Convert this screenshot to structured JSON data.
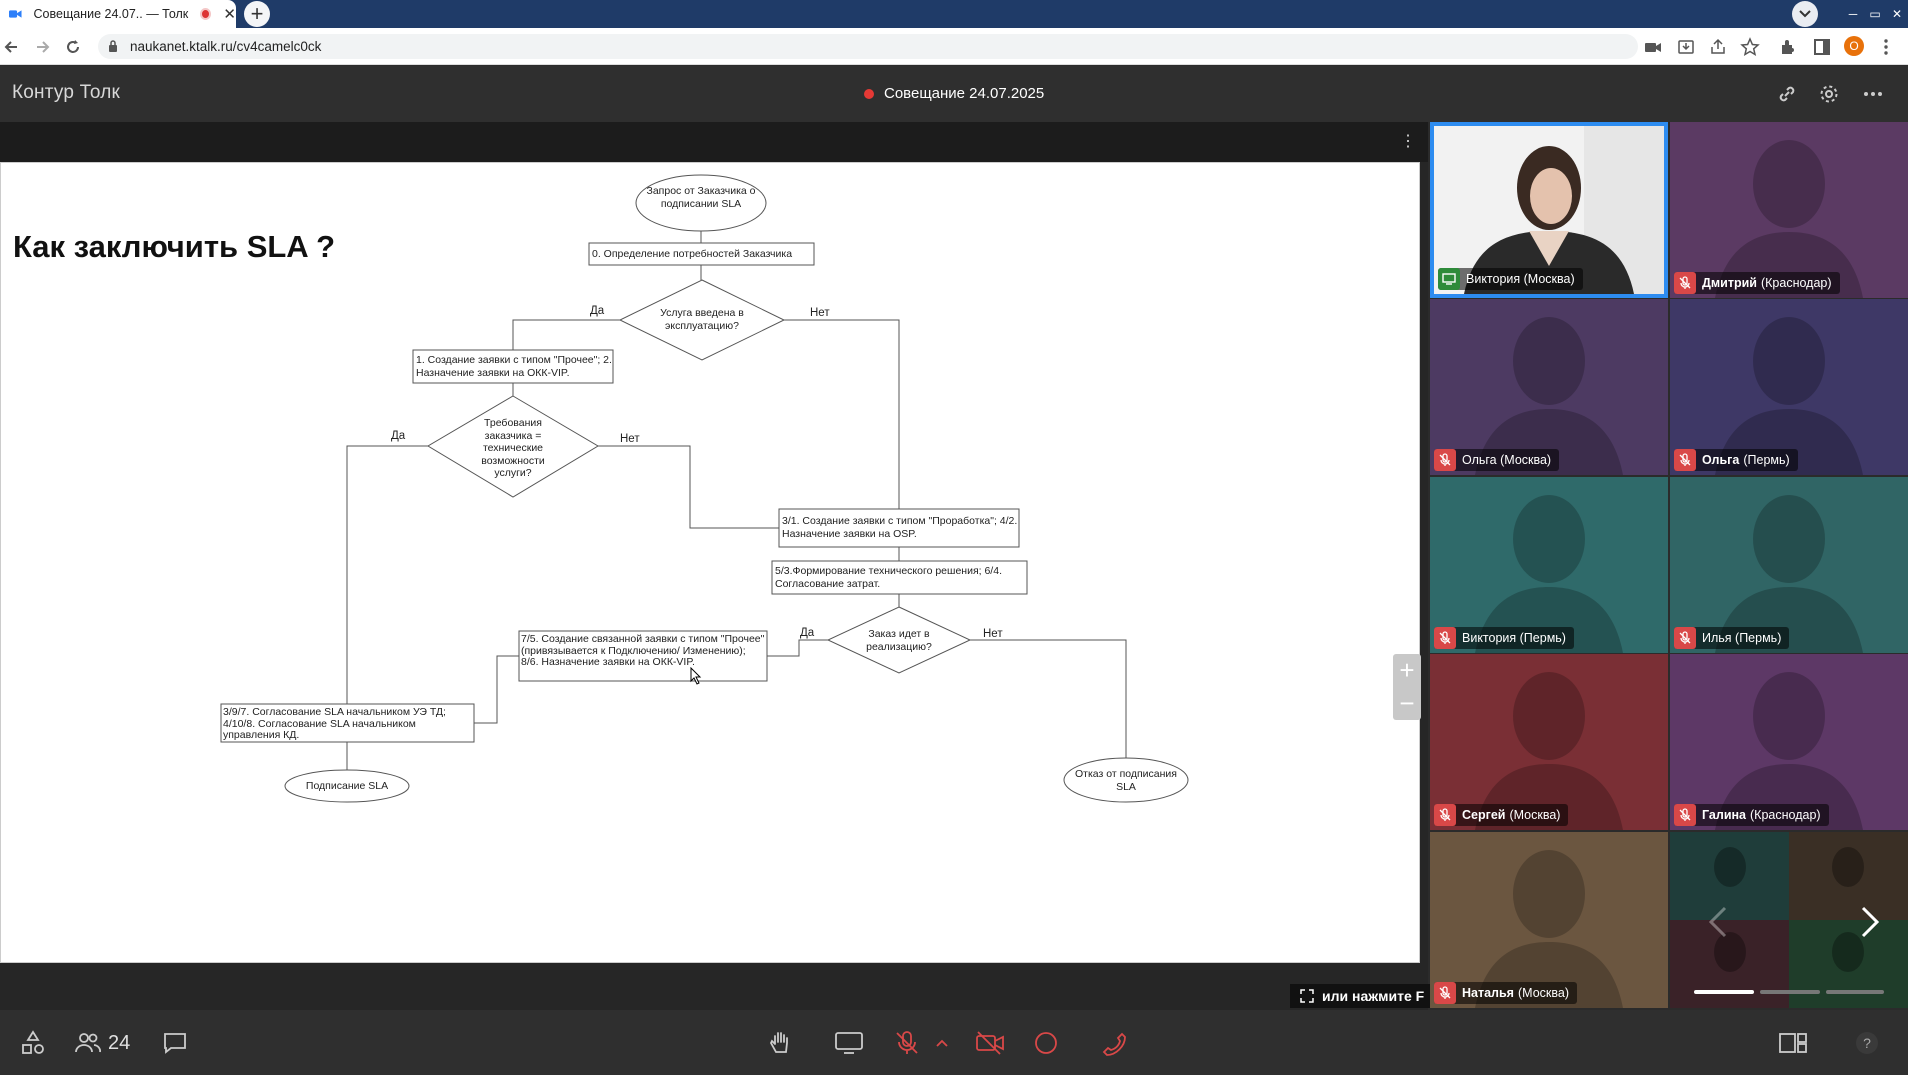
{
  "browser": {
    "tab_title": "Совещание 24.07.. — Толк",
    "url": "naukanet.ktalk.ru/cv4camelc0ck",
    "profile_initial": "O"
  },
  "app": {
    "logo": "Контур Толк",
    "meeting_title": "Совещание 24.07.2025",
    "fullscreen_hint": "или нажмите F",
    "participant_count": "24"
  },
  "slide": {
    "title": "Как заключить SLA ?",
    "nodes": {
      "start": "Запрос от Заказчика о подписании SLA",
      "step0": "0. Определение потребностей Заказчика",
      "q1": "Услуга введена в эксплуатацию?",
      "step12": "1. Создание заявки с типом \"Прочее\"; 2. Назначение заявки на ОКК-VIP.",
      "q2": "Требования заказчика = технические возможности услуги?",
      "step3142": "3/1. Создание заявки с типом \"Проработка\"; 4/2. Назначение заявки на OSP.",
      "step5364": "5/3.Формирование технического решения; 6/4. Согласование затрат.",
      "q3": "Заказ идет в реализацию?",
      "step7586": "7/5. Создание связанной заявки с типом \"Прочее\" (привязывается к Подключению/ Изменению); 8/6. Назначение заявки на ОКК-VIP.",
      "step397": "3/9/7. Согласование SLA начальником УЭ ТД; 4/10/8. Согласование SLA начальником управления КД.",
      "end_sign": "Подписание SLA",
      "end_refuse": "Отказ от подписания SLA"
    },
    "labels": {
      "q1_yes": "Да",
      "q1_no": "Нет",
      "q2_yes": "Да",
      "q2_no": "Нет",
      "q3_yes": "Да",
      "q3_no": "Нет"
    }
  },
  "participants": [
    {
      "first": "",
      "rest": "Виктория (Москва)",
      "muted": false,
      "sharing": true,
      "bg": "#ffffff"
    },
    {
      "first": "Дмитрий",
      "rest": "(Краснодар)",
      "muted": true,
      "bg": "#5b3a63"
    },
    {
      "first": "",
      "rest": "Ольга (Москва)",
      "muted": true,
      "bg": "#4d3a62"
    },
    {
      "first": "Ольга",
      "rest": "(Пермь)",
      "muted": true,
      "bg": "#3e3866"
    },
    {
      "first": "",
      "rest": "Виктория (Пермь)",
      "muted": true,
      "bg": "#2f6a6a"
    },
    {
      "first": "",
      "rest": "Илья (Пермь)",
      "muted": true,
      "bg": "#306565"
    },
    {
      "first": "Сергей",
      "rest": "(Москва)",
      "muted": true,
      "bg": "#7a2f35"
    },
    {
      "first": "Галина",
      "rest": "(Краснодар)",
      "muted": true,
      "bg": "#5d3866"
    },
    {
      "first": "Наталья",
      "rest": "(Москва)",
      "muted": true,
      "bg": "#6b5640"
    }
  ],
  "colors": {
    "accent": "#2d8cf0",
    "recording": "#e53935",
    "muted": "#d94848",
    "header_bg": "#2f2f2f",
    "tabbar_bg": "#1f3b68"
  }
}
